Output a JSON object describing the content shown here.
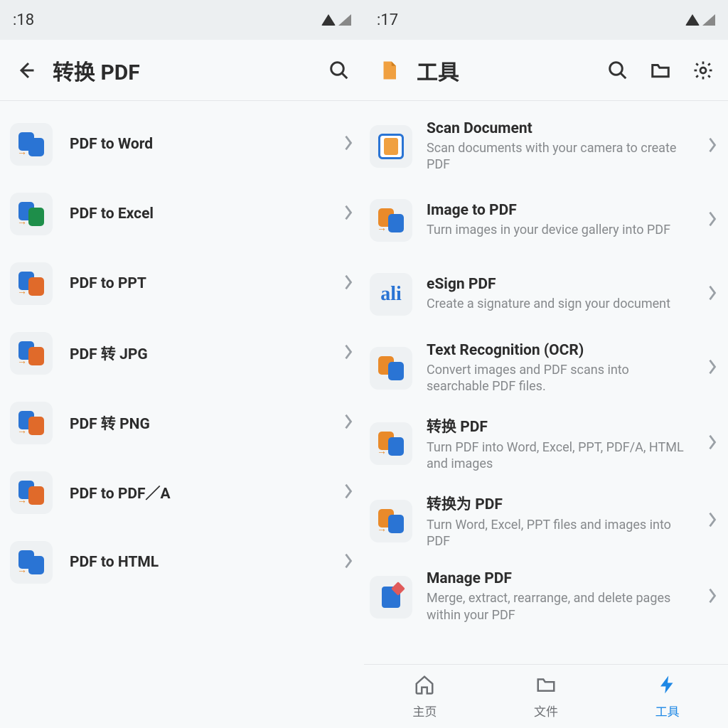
{
  "left": {
    "status_time": ":18",
    "title": "转换 PDF",
    "items": [
      {
        "label": "PDF to Word",
        "accent": "#2a74d4"
      },
      {
        "label": "PDF to Excel",
        "accent": "#1e8e4a"
      },
      {
        "label": "PDF to PPT",
        "accent": "#e06a2a"
      },
      {
        "label": "PDF 转 JPG",
        "accent": "#e06a2a"
      },
      {
        "label": "PDF 转 PNG",
        "accent": "#e06a2a"
      },
      {
        "label": "PDF to PDF／A",
        "accent": "#e06a2a"
      },
      {
        "label": "PDF to HTML",
        "accent": "#2a74d4"
      }
    ]
  },
  "right": {
    "status_time": ":17",
    "title": "工具",
    "items": [
      {
        "title": "Scan Document",
        "desc": "Scan documents with your camera to create PDF",
        "icon": "scan"
      },
      {
        "title": "Image to PDF",
        "desc": "Turn images in your device gallery into PDF",
        "icon": "pair-orange"
      },
      {
        "title": "eSign PDF",
        "desc": "Create a signature and sign your document",
        "icon": "signature"
      },
      {
        "title": "Text Recognition (OCR)",
        "desc": "Convert images and PDF scans into searchable PDF files.",
        "icon": "pair-ocr"
      },
      {
        "title": "转换 PDF",
        "desc": "Turn PDF into Word, Excel, PPT, PDF/A, HTML and images",
        "icon": "pair-orange"
      },
      {
        "title": "转换为 PDF",
        "desc": "Turn Word, Excel, PPT files and images into PDF",
        "icon": "pair-orange"
      },
      {
        "title": "Manage PDF",
        "desc": "Merge, extract, rearrange, and delete pages within your PDF",
        "icon": "pencil"
      }
    ],
    "tabs": [
      {
        "label": "主页",
        "icon": "home",
        "active": false
      },
      {
        "label": "文件",
        "icon": "folder",
        "active": false
      },
      {
        "label": "工具",
        "icon": "bolt",
        "active": true
      }
    ]
  },
  "colors": {
    "accent_blue": "#1E88E5",
    "icon_bg": "#eef1f3",
    "text_primary": "#2c2c2c",
    "text_secondary": "#86898c"
  }
}
